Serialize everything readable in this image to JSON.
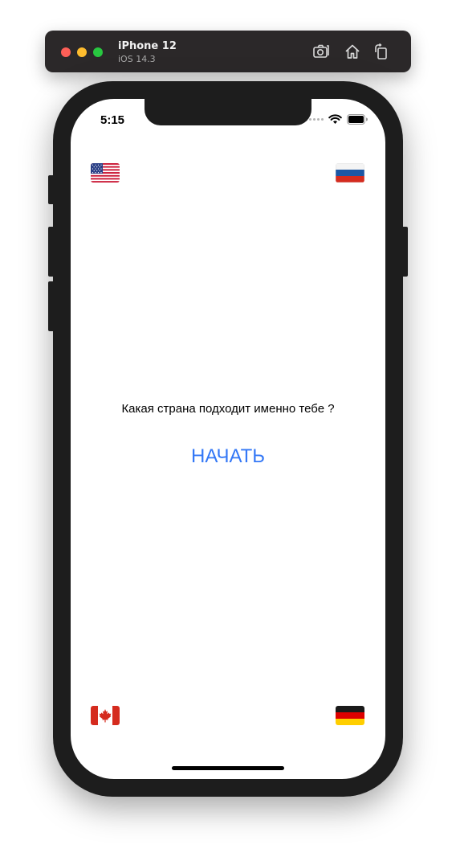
{
  "window": {
    "device_name": "iPhone 12",
    "os_version": "iOS 14.3",
    "buttons": [
      {
        "icon": "screenshot-icon"
      },
      {
        "icon": "home-icon"
      },
      {
        "icon": "rotate-icon"
      }
    ]
  },
  "status_bar": {
    "time": "5:15",
    "icons": [
      "signal-dots-icon",
      "wifi-icon",
      "battery-icon"
    ]
  },
  "flags": {
    "top_left": "usa-flag-icon",
    "top_right": "russia-flag-icon",
    "bottom_left": "canada-flag-icon",
    "bottom_right": "germany-flag-icon"
  },
  "main": {
    "question": "Какая страна подходит именно тебе ?",
    "start_label": "НАЧАТЬ"
  },
  "colors": {
    "accent": "#3478f6",
    "phone_frame": "#1d1d1d",
    "titlebar": "#2b2829"
  }
}
